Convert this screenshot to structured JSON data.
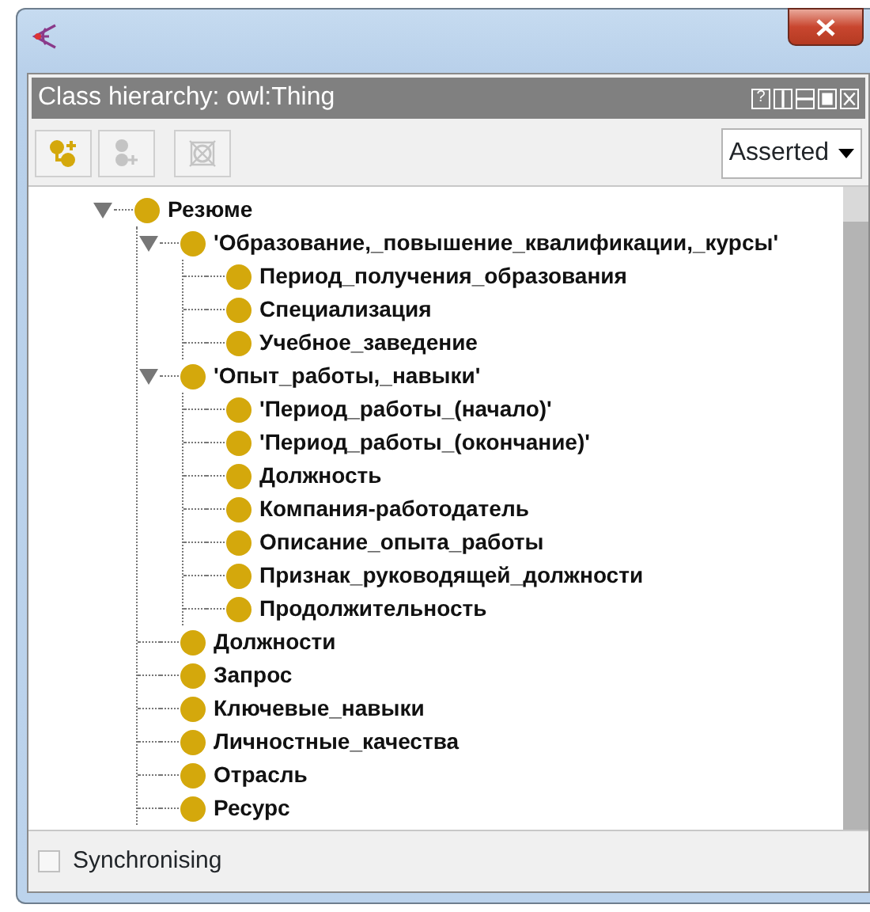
{
  "panel": {
    "title": "Class hierarchy: owl:Thing",
    "header_buttons": [
      "?"
    ]
  },
  "toolbar": {
    "buttons": [
      {
        "kind": "add-subclass",
        "disabled": false
      },
      {
        "kind": "add-sibling",
        "disabled": true
      },
      {
        "kind": "delete",
        "disabled": true
      }
    ],
    "mode": "Asserted"
  },
  "tree": [
    {
      "label": "Резюме",
      "expanded": true,
      "children": [
        {
          "label": "'Образование,_повышение_квалификации,_курсы'",
          "expanded": true,
          "children": [
            {
              "label": "Период_получения_образования"
            },
            {
              "label": "Специализация"
            },
            {
              "label": "Учебное_заведение"
            }
          ]
        },
        {
          "label": "'Опыт_работы,_навыки'",
          "expanded": true,
          "children": [
            {
              "label": "'Период_работы_(начало)'"
            },
            {
              "label": "'Период_работы_(окончание)'"
            },
            {
              "label": "Должность"
            },
            {
              "label": "Компания-работодатель"
            },
            {
              "label": "Описание_опыта_работы"
            },
            {
              "label": "Признак_руководящей_должности"
            },
            {
              "label": "Продолжительность"
            }
          ]
        },
        {
          "label": "Должности"
        },
        {
          "label": "Запрос"
        },
        {
          "label": "Ключевые_навыки"
        },
        {
          "label": "Личностные_качества"
        },
        {
          "label": "Отрасль"
        },
        {
          "label": "Ресурс"
        }
      ]
    }
  ],
  "sync": {
    "label": "Synchronising",
    "checked": false
  }
}
